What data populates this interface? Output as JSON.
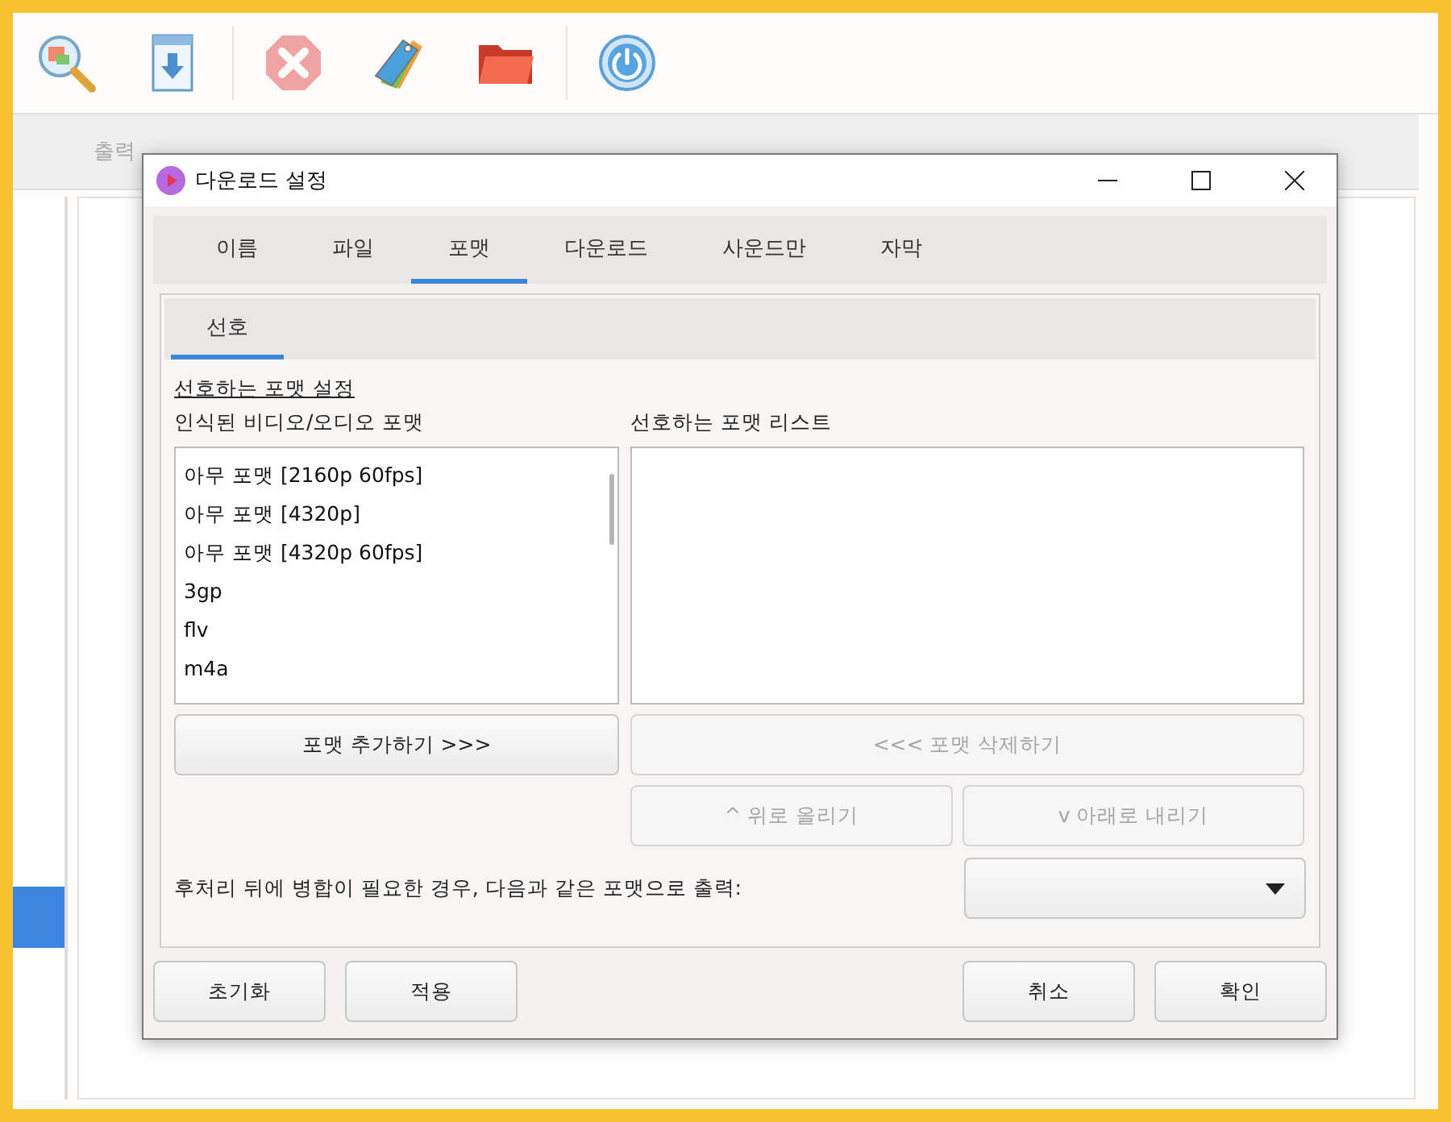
{
  "app": {
    "toolbar": [
      {
        "kind": "search",
        "disabled": false
      },
      {
        "kind": "download",
        "disabled": false
      },
      {
        "kind": "stop",
        "disabled": true
      },
      {
        "kind": "tags",
        "disabled": false
      },
      {
        "kind": "folder",
        "disabled": false
      },
      {
        "kind": "power",
        "disabled": false
      }
    ],
    "tabs": [
      {
        "label": "출력",
        "selected": false
      }
    ]
  },
  "dialog": {
    "title": "다운로드 설정",
    "tabs": [
      {
        "label": "이름",
        "selected": false
      },
      {
        "label": "파일",
        "selected": false
      },
      {
        "label": "포맷",
        "selected": true
      },
      {
        "label": "다운로드",
        "selected": false
      },
      {
        "label": "사운드만",
        "selected": false
      },
      {
        "label": "자막",
        "selected": false
      }
    ],
    "subtabs": [
      {
        "label": "선호",
        "selected": true
      }
    ],
    "section_title": "선호하는 포맷 설정",
    "detected_label": "인식된 비디오/오디오 포맷",
    "preferred_label": "선호하는 포맷 리스트",
    "detected_formats": [
      {
        "label": "아무 포맷 [2160p 60fps]",
        "selected": false
      },
      {
        "label": "아무 포맷 [4320p]",
        "selected": false
      },
      {
        "label": "아무 포맷 [4320p 60fps]",
        "selected": false
      },
      {
        "label": "3gp",
        "selected": false
      },
      {
        "label": "flv",
        "selected": false
      },
      {
        "label": "m4a",
        "selected": false
      }
    ],
    "add_button": {
      "label": "포맷 추가하기 >>>",
      "disabled": false
    },
    "remove_button": {
      "label": "<<< 포맷 삭제하기",
      "disabled": true
    },
    "up_button": {
      "label": "^ 위로 올리기",
      "disabled": true
    },
    "down_button": {
      "label": "v 아래로 내리기",
      "disabled": true
    },
    "merge_label": "후처리 뒤에 병합이 필요한 경우, 다음과 같은 포맷으로 출력:",
    "footer_left": [
      {
        "label": "초기화",
        "disabled": false
      },
      {
        "label": "적용",
        "disabled": false
      }
    ],
    "footer_right": [
      {
        "label": "취소",
        "disabled": false
      },
      {
        "label": "확인",
        "disabled": false
      }
    ]
  }
}
